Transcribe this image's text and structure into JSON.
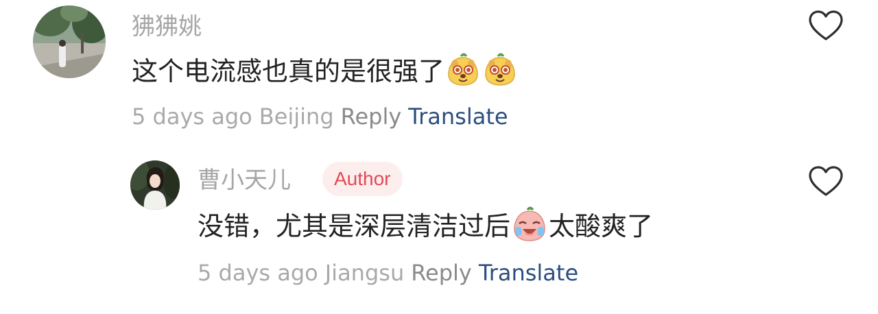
{
  "comments": [
    {
      "username": "狒狒姚",
      "text": "这个电流感也真的是很强了",
      "text_emojis": [
        "happy-dog-emoji",
        "happy-dog-emoji"
      ],
      "time": "5 days ago",
      "location": "Beijing",
      "reply_label": "Reply",
      "translate_label": "Translate",
      "avatar_icon": "avatar-photo-outdoor",
      "like_icon": "heart-outline-icon"
    },
    {
      "username": "曹小天儿",
      "badge": "Author",
      "text_before": "没错，尤其是深层清洁过后",
      "text_emoji": "crying-laugh-emoji",
      "text_after": "太酸爽了",
      "time": "5 days ago",
      "location": "Jiangsu",
      "reply_label": "Reply",
      "translate_label": "Translate",
      "avatar_icon": "avatar-photo-portrait",
      "like_icon": "heart-outline-icon"
    }
  ],
  "colors": {
    "username": "#a6a6a6",
    "text": "#222222",
    "meta": "#a9a9a9",
    "reply": "#8a8a8a",
    "translate": "#2b4e7e",
    "badge_bg": "#fdeeee",
    "badge_text": "#e04a57"
  }
}
